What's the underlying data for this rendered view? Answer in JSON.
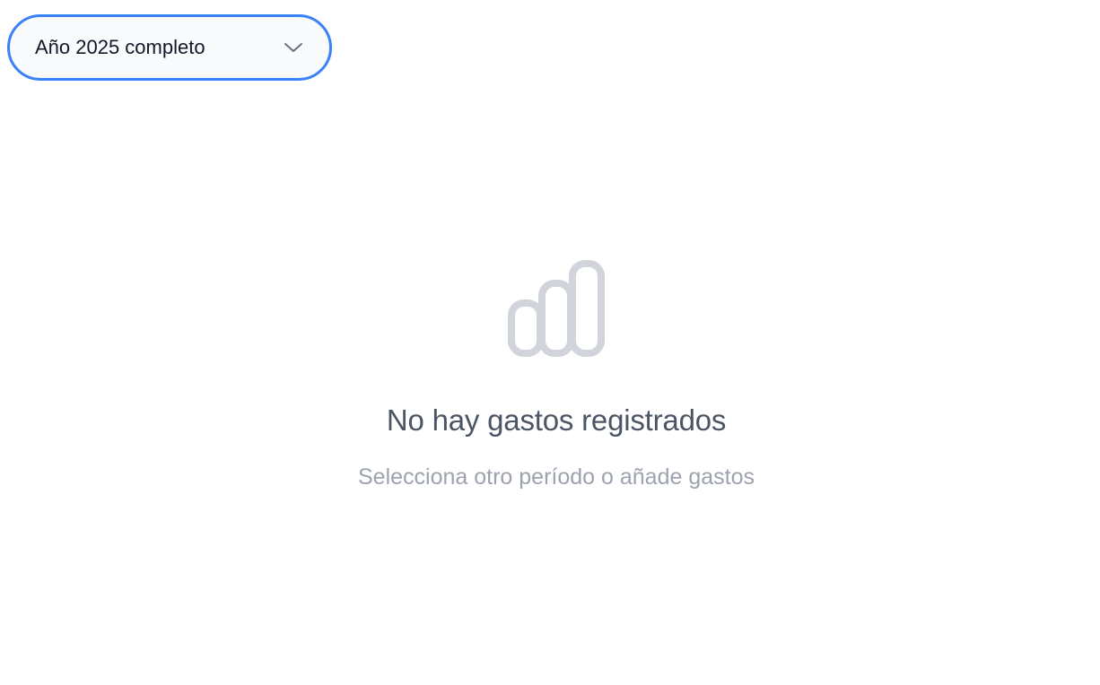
{
  "period_select": {
    "selected_label": "Año 2025 completo",
    "icon": "chevron-down-icon"
  },
  "empty_state": {
    "icon": "bar-chart-icon",
    "title": "No hay gastos registrados",
    "subtitle": "Selecciona otro período o añade gastos"
  },
  "colors": {
    "accent": "#3b82f6",
    "title": "#4b5563",
    "subtitle": "#9ca3af",
    "icon": "#d1d5db"
  }
}
